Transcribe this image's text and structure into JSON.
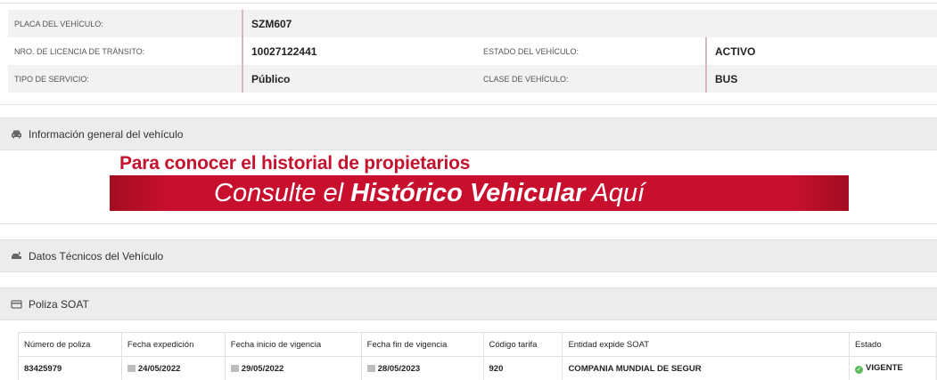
{
  "vehicle": {
    "plate_label": "PLACA DEL VEHÍCULO:",
    "plate_value": "SZM607",
    "license_label": "NRO. DE LICENCIA DE TRÁNSITO:",
    "license_value": "10027122441",
    "state_label": "ESTADO DEL VEHÍCULO:",
    "state_value": "ACTIVO",
    "service_label": "TIPO DE SERVICIO:",
    "service_value": "Público",
    "class_label": "CLASE DE VEHÍCULO:",
    "class_value": "BUS"
  },
  "sections": {
    "general": "Información general del vehículo",
    "technical": "Datos Técnicos del Vehículo",
    "soat": "Poliza SOAT"
  },
  "banner": {
    "title": "Para conocer el historial de propietarios",
    "cta_prefix": "Consulte el ",
    "cta_bold": "Histórico Vehicular",
    "cta_suffix": " Aquí"
  },
  "soat_table": {
    "headers": [
      "Número de poliza",
      "Fecha expedición",
      "Fecha inicio de vigencia",
      "Fecha fin de vigencia",
      "Código tarifa",
      "Entidad expide SOAT",
      "Estado"
    ],
    "row": {
      "policy": "83425979",
      "issued": "24/05/2022",
      "start": "29/05/2022",
      "end": "28/05/2023",
      "rate_code": "920",
      "entity": "COMPANIA MUNDIAL DE SEGUR",
      "status": "VIGENTE"
    }
  },
  "icons": {
    "car": "car-icon",
    "tech": "gear-car-icon",
    "card": "card-icon",
    "calendar": "calendar-icon",
    "check": "check-circle-icon"
  },
  "colors": {
    "accent": "#c8102e",
    "status_ok": "#5cb85c"
  }
}
